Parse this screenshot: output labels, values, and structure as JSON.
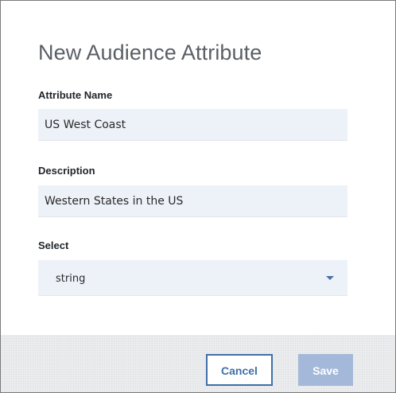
{
  "dialog": {
    "title": "New Audience Attribute"
  },
  "fields": {
    "attribute_name": {
      "label": "Attribute Name",
      "value": "US West Coast"
    },
    "description": {
      "label": "Description",
      "value": "Western States in the US"
    },
    "select": {
      "label": "Select",
      "value": "string"
    }
  },
  "footer": {
    "cancel_label": "Cancel",
    "save_label": "Save"
  },
  "colors": {
    "accent": "#3f6fa8",
    "field_background": "#edf2f9",
    "save_disabled": "#a4b9d9",
    "footer_background": "#ecedef"
  },
  "icons": {
    "select_arrow": "chevron-down-icon"
  }
}
